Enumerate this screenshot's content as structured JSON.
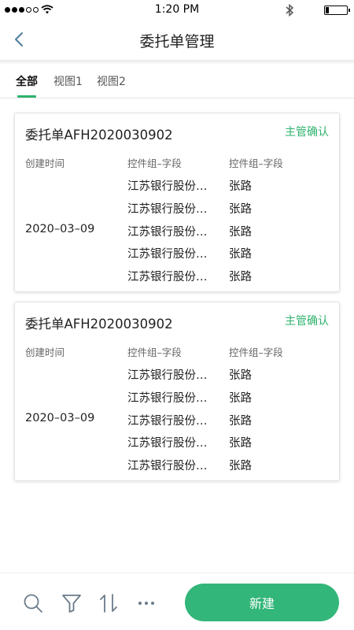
{
  "status_bar": {
    "time": "1:20 PM",
    "battery_level": 0.15
  },
  "nav": {
    "title": "委托单管理",
    "back_icon": "chevron-left-icon"
  },
  "tabs": [
    {
      "label": "全部",
      "active": true
    },
    {
      "label": "视图1",
      "active": false
    },
    {
      "label": "视图2",
      "active": false
    }
  ],
  "cards": [
    {
      "title": "委托单AFH2020030902",
      "status": "主管确认",
      "headers": [
        "创建时间",
        "控件组–字段",
        "控件组–字段"
      ],
      "date": "2020–03–09",
      "rows": [
        {
          "company": "江苏银行股份…",
          "name": "张路"
        },
        {
          "company": "江苏银行股份…",
          "name": "张路"
        },
        {
          "company": "江苏银行股份…",
          "name": "张路"
        },
        {
          "company": "江苏银行股份…",
          "name": "张路"
        },
        {
          "company": "江苏银行股份…",
          "name": "张路"
        }
      ]
    },
    {
      "title": "委托单AFH2020030902",
      "status": "主管确认",
      "headers": [
        "创建时间",
        "控件组–字段",
        "控件组–字段"
      ],
      "date": "2020–03–09",
      "rows": [
        {
          "company": "江苏银行股份…",
          "name": "张路"
        },
        {
          "company": "江苏银行股份…",
          "name": "张路"
        },
        {
          "company": "江苏银行股份…",
          "name": "张路"
        },
        {
          "company": "江苏银行股份…",
          "name": "张路"
        },
        {
          "company": "江苏银行股份…",
          "name": "张路"
        }
      ]
    }
  ],
  "toolbar": {
    "icons": [
      "search-icon",
      "filter-icon",
      "sort-icon",
      "more-icon"
    ],
    "new_label": "新建"
  },
  "colors": {
    "accent": "#33b679",
    "status_text": "#2fb26e"
  }
}
